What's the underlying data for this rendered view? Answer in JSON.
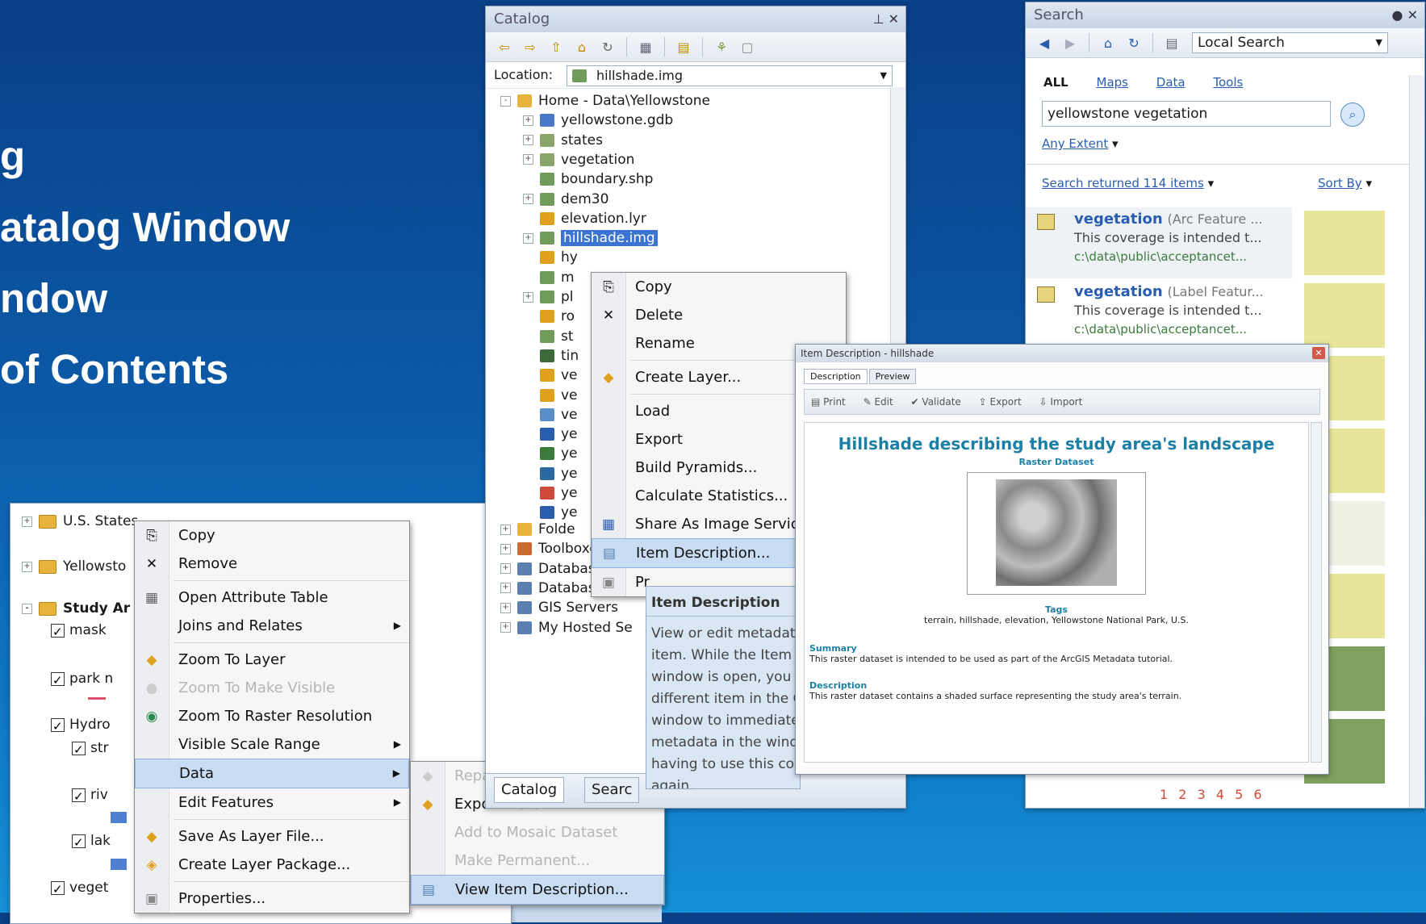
{
  "bullets": [
    "g",
    "atalog Window",
    "ndow",
    "of Contents"
  ],
  "toc": {
    "rows": [
      "U.S. States",
      "Yellowsto",
      "Study Ar",
      "mask",
      "park n",
      "Hydro",
      "str",
      "riv",
      "lak",
      "veget"
    ]
  },
  "toc_menu": {
    "items": [
      {
        "label": "Copy",
        "icon": "copy-icon"
      },
      {
        "label": "Remove",
        "icon": "remove-icon"
      },
      {
        "label": "Open Attribute Table",
        "icon": "table-icon"
      },
      {
        "label": "Joins and Relates",
        "submenu": true
      },
      {
        "label": "Zoom To Layer",
        "icon": "zoom-layer-icon"
      },
      {
        "label": "Zoom To Make Visible",
        "disabled": true
      },
      {
        "label": "Zoom To Raster Resolution",
        "icon": "zoom-raster-icon"
      },
      {
        "label": "Visible Scale Range",
        "submenu": true
      },
      {
        "label": "Data",
        "submenu": true,
        "highlighted": true
      },
      {
        "label": "Edit Features",
        "submenu": true
      },
      {
        "label": "Save As Layer File...",
        "icon": "layer-file-icon"
      },
      {
        "label": "Create Layer Package...",
        "icon": "package-icon"
      },
      {
        "label": "Properties...",
        "icon": "properties-icon"
      }
    ]
  },
  "data_submenu": {
    "items": [
      {
        "label": "Repair Data Source...",
        "disabled": true
      },
      {
        "label": "Export Data...",
        "disabled": false
      },
      {
        "label": "Add to Mosaic Dataset",
        "disabled": true
      },
      {
        "label": "Make Permanent...",
        "disabled": true
      },
      {
        "label": "View Item Description...",
        "highlighted": true
      }
    ]
  },
  "catalog": {
    "title": "Catalog",
    "location_label": "Location:",
    "location_value": "hillshade.img",
    "tree": [
      {
        "label": "Home - Data\\Yellowstone",
        "level": 0
      },
      {
        "label": "yellowstone.gdb",
        "level": 1
      },
      {
        "label": "states",
        "level": 1
      },
      {
        "label": "vegetation",
        "level": 1
      },
      {
        "label": "boundary.shp",
        "level": 1
      },
      {
        "label": "dem30",
        "level": 1
      },
      {
        "label": "elevation.lyr",
        "level": 1
      },
      {
        "label": "hillshade.img",
        "level": 1,
        "selected": true
      },
      {
        "label": "hy",
        "level": 1
      },
      {
        "label": "m",
        "level": 1
      },
      {
        "label": "pl",
        "level": 1
      },
      {
        "label": "ro",
        "level": 1
      },
      {
        "label": "st",
        "level": 1
      },
      {
        "label": "tin",
        "level": 1
      },
      {
        "label": "ve",
        "level": 1
      },
      {
        "label": "ve",
        "level": 1
      },
      {
        "label": "ve",
        "level": 1
      },
      {
        "label": "ye",
        "level": 1
      },
      {
        "label": "ye",
        "level": 1
      },
      {
        "label": "ye",
        "level": 1
      },
      {
        "label": "ye",
        "level": 1
      },
      {
        "label": "ye",
        "level": 1
      },
      {
        "label": "Folde",
        "level": 0
      },
      {
        "label": "Toolboxes",
        "level": 0
      },
      {
        "label": "Database Serv",
        "level": 0
      },
      {
        "label": "Database Con",
        "level": 0
      },
      {
        "label": "GIS Servers",
        "level": 0
      },
      {
        "label": "My Hosted Se",
        "level": 0
      }
    ],
    "tabs": [
      "Catalog",
      "Searc"
    ]
  },
  "catalog_menu": {
    "items": [
      {
        "label": "Copy",
        "icon": "copy-icon"
      },
      {
        "label": "Delete",
        "icon": "delete-icon"
      },
      {
        "label": "Rename"
      },
      {
        "label": "Create Layer...",
        "icon": "layer-icon"
      },
      {
        "label": "Load"
      },
      {
        "label": "Export"
      },
      {
        "label": "Build Pyramids..."
      },
      {
        "label": "Calculate Statistics..."
      },
      {
        "label": "Share As Image Service",
        "icon": "image-service-icon"
      },
      {
        "label": "Item Description...",
        "highlighted": true
      },
      {
        "label": "Pr",
        "icon": "properties-icon"
      }
    ]
  },
  "tooltip": {
    "title": "Item Description",
    "text": "View or edit metadata for this item. While the Item Description window is open, you can select a different item in the Catalog window to immediately see its metadata in the window without having to use this command again."
  },
  "search": {
    "title": "Search",
    "scope": "Local Search",
    "filters": [
      "ALL",
      "Maps",
      "Data",
      "Tools"
    ],
    "query": "yellowstone vegetation",
    "extent": "Any Extent",
    "summary": "Search returned 114 items",
    "sort": "Sort By",
    "results": [
      {
        "title": "vegetation",
        "type": "(Arc Feature ...",
        "desc": "This coverage is intended t...",
        "path": "c:\\data\\public\\acceptancet..."
      },
      {
        "title": "vegetation",
        "type": "(Label Featur...",
        "desc": "This coverage is intended t...",
        "path": "c:\\data\\public\\acceptancet..."
      }
    ],
    "pages": "1 2 3 4 5 6"
  },
  "item_description": {
    "window_title": "Item Description - hillshade",
    "tabs": [
      "Description",
      "Preview"
    ],
    "tools": [
      "Print",
      "Edit",
      "Validate",
      "Export",
      "Import"
    ],
    "heading": "Hillshade describing the study area's landscape",
    "subtype": "Raster Dataset",
    "tags_label": "Tags",
    "tags": "terrain, hillshade, elevation, Yellowstone National Park, U.S.",
    "summary_label": "Summary",
    "summary": "This raster dataset is intended to be used as part of the ArcGIS Metadata tutorial.",
    "description_label": "Description",
    "description": "This raster dataset contains a shaded surface representing the study area's terrain."
  }
}
